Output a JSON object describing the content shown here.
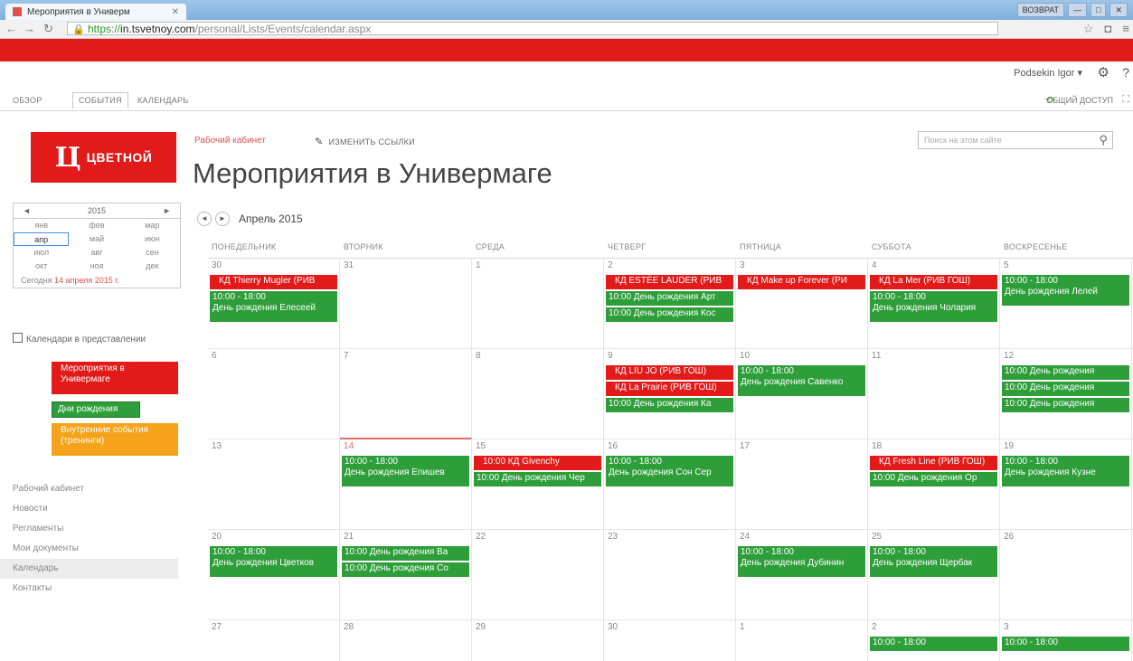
{
  "browser": {
    "tab_title": "Мероприятия в Универм",
    "url_scheme": "https://",
    "url_domain": "in.tsvetnoy.com",
    "url_path": "/personal/Lists/Events/calendar.aspx",
    "window_buttons": [
      "ВОЗВРАТ",
      "—",
      "□",
      "✕"
    ]
  },
  "suite": {
    "user_name": "Podsekin Igor ▾"
  },
  "ribbon": {
    "tabs": [
      "ОБЗОР",
      "СОБЫТИЯ",
      "КАЛЕНДАРЬ"
    ],
    "share_label": "ОБЩИЙ ДОСТУП"
  },
  "logo": {
    "mark": "Ц",
    "word": "ЦВЕТНОЙ"
  },
  "header": {
    "breadcrumb": "Рабочий кабинет",
    "edit_links": "ИЗМЕНИТЬ ССЫЛКИ",
    "title": "Мероприятия в Универмаге",
    "search_placeholder": "Поиск на этом сайте"
  },
  "minical": {
    "year": "2015",
    "months": [
      "янв",
      "фев",
      "мар",
      "апр",
      "май",
      "июн",
      "июл",
      "авг",
      "сен",
      "окт",
      "ноя",
      "дек"
    ],
    "selected_month": "апр",
    "today_prefix": "Сегодня ",
    "today_date": "14 апреля 2015 г."
  },
  "calendars_in_view": {
    "label": "Календари в представлении",
    "legend": [
      {
        "label": "Мероприятия в Универмаге",
        "color": "#e21a1a"
      },
      {
        "label": "Дни рождения",
        "color": "#2e9e3a"
      },
      {
        "label": "Внутренние события (тренинги)",
        "color": "#f5a31a"
      }
    ]
  },
  "left_nav": [
    {
      "label": "Рабочий кабинет",
      "selected": false
    },
    {
      "label": "Новости",
      "selected": false
    },
    {
      "label": "Регламенты",
      "selected": false
    },
    {
      "label": "Мои документы",
      "selected": false
    },
    {
      "label": "Календарь",
      "selected": true
    },
    {
      "label": "Контакты",
      "selected": false
    }
  ],
  "calendar": {
    "month_label": "Апрель 2015",
    "day_headers": [
      "ПОНЕДЕЛЬНИК",
      "ВТОРНИК",
      "СРЕДА",
      "ЧЕТВЕРГ",
      "ПЯТНИЦА",
      "СУББОТА",
      "ВОСКРЕСЕНЬЕ"
    ],
    "weeks": [
      [
        {
          "day": "30",
          "events": [
            {
              "kind": "red",
              "text": "КД Thierry Mugler (РИВ"
            },
            {
              "kind": "green2",
              "line1": "10:00 - 18:00",
              "line2": "День рождения Елесеей"
            }
          ]
        },
        {
          "day": "31",
          "events": []
        },
        {
          "day": "1",
          "events": []
        },
        {
          "day": "2",
          "events": [
            {
              "kind": "red",
              "text": "КД ESTÉE LAUDER (РИВ"
            },
            {
              "kind": "green1",
              "text": "10:00 День рождения Арт"
            },
            {
              "kind": "green1",
              "text": "10:00 День рождения Кос"
            }
          ]
        },
        {
          "day": "3",
          "events": [
            {
              "kind": "red",
              "text": "КД Make up Forever (РИ"
            }
          ]
        },
        {
          "day": "4",
          "events": [
            {
              "kind": "red",
              "text": "КД La Mer (РИВ ГОШ)"
            },
            {
              "kind": "green2",
              "line1": "10:00 - 18:00",
              "line2": "День рождения Чолария"
            }
          ]
        },
        {
          "day": "5",
          "events": [
            {
              "kind": "green2",
              "line1": "10:00 - 18:00",
              "line2": "День рождения Лелей"
            }
          ]
        }
      ],
      [
        {
          "day": "6",
          "events": []
        },
        {
          "day": "7",
          "events": []
        },
        {
          "day": "8",
          "events": []
        },
        {
          "day": "9",
          "events": [
            {
              "kind": "red",
              "text": "КД LIU JO (РИВ ГОШ)"
            },
            {
              "kind": "red",
              "text": "КД La Prairie (РИВ ГОШ)"
            },
            {
              "kind": "green1",
              "text": "10:00 День рождения Ка"
            }
          ]
        },
        {
          "day": "10",
          "events": [
            {
              "kind": "green2",
              "line1": "10:00 - 18:00",
              "line2": "День рождения Савенко"
            }
          ]
        },
        {
          "day": "11",
          "events": []
        },
        {
          "day": "12",
          "events": [
            {
              "kind": "green1",
              "text": "10:00 День рождения"
            },
            {
              "kind": "green1",
              "text": "10:00 День рождения"
            },
            {
              "kind": "green1",
              "text": "10:00 День рождения"
            }
          ]
        }
      ],
      [
        {
          "day": "13",
          "events": []
        },
        {
          "day": "14",
          "today": true,
          "events": [
            {
              "kind": "green2",
              "line1": "10:00 - 18:00",
              "line2": "День рождения Епишев"
            }
          ]
        },
        {
          "day": "15",
          "events": [
            {
              "kind": "red",
              "text": "10:00 КД Givenchy"
            },
            {
              "kind": "green1",
              "text": "10:00 День рождения Чер"
            }
          ]
        },
        {
          "day": "16",
          "events": [
            {
              "kind": "green2",
              "line1": "10:00 - 18:00",
              "line2": "День рождения Сон Сер"
            }
          ]
        },
        {
          "day": "17",
          "events": []
        },
        {
          "day": "18",
          "events": [
            {
              "kind": "red",
              "text": "КД Fresh Line (РИВ ГОШ)"
            },
            {
              "kind": "green1",
              "text": "10:00 День рождения Ор"
            }
          ]
        },
        {
          "day": "19",
          "events": [
            {
              "kind": "green2",
              "line1": "10:00 - 18:00",
              "line2": "День рождения Кузне"
            }
          ]
        }
      ],
      [
        {
          "day": "20",
          "events": [
            {
              "kind": "green2",
              "line1": "10:00 - 18:00",
              "line2": "День рождения Цветков"
            }
          ]
        },
        {
          "day": "21",
          "events": [
            {
              "kind": "green1",
              "text": "10:00 День рождения Ва"
            },
            {
              "kind": "green1",
              "text": "10:00 День рождения Со"
            }
          ]
        },
        {
          "day": "22",
          "events": []
        },
        {
          "day": "23",
          "events": []
        },
        {
          "day": "24",
          "events": [
            {
              "kind": "green2",
              "line1": "10:00 - 18:00",
              "line2": "День рождения Дубинин"
            }
          ]
        },
        {
          "day": "25",
          "events": [
            {
              "kind": "green2",
              "line1": "10:00 - 18:00",
              "line2": "День рождения Щербак"
            }
          ]
        },
        {
          "day": "26",
          "events": []
        }
      ],
      [
        {
          "day": "27",
          "events": []
        },
        {
          "day": "28",
          "events": []
        },
        {
          "day": "29",
          "events": []
        },
        {
          "day": "30",
          "events": []
        },
        {
          "day": "1",
          "events": []
        },
        {
          "day": "2",
          "events": [
            {
              "kind": "green1",
              "text": "10:00 - 18:00"
            }
          ]
        },
        {
          "day": "3",
          "events": [
            {
              "kind": "green1",
              "text": "10:00 - 18:00"
            }
          ]
        }
      ]
    ]
  }
}
